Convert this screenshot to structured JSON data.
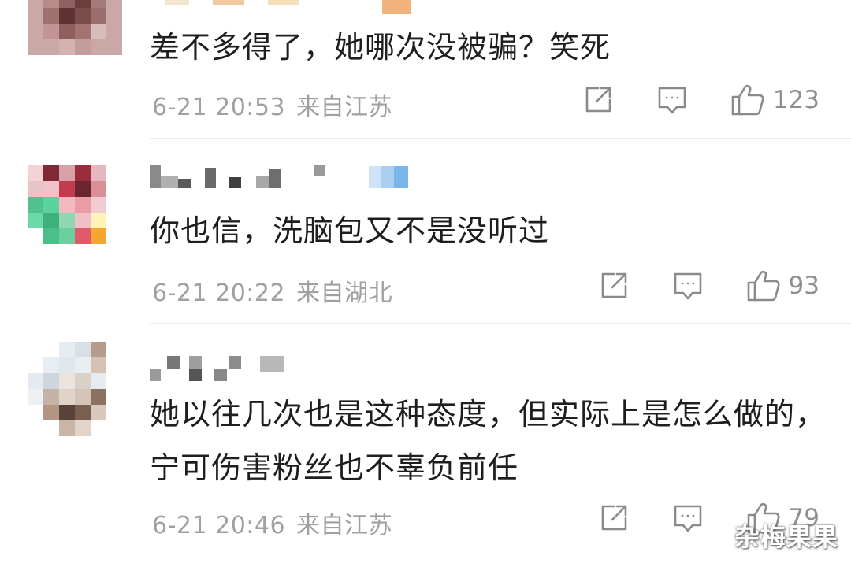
{
  "comments": [
    {
      "text": "差不多得了，她哪次没被骗？笑死",
      "time": "6-21 20:53",
      "location": "来自江苏",
      "likes": "123"
    },
    {
      "text": "你也信，洗脑包又不是没听过",
      "time": "6-21 20:22",
      "location": "来自湖北",
      "likes": "93"
    },
    {
      "text": "她以往几次也是这种态度，但实际上是怎么做的，宁可伤害粉丝也不辜负前任",
      "time": "6-21 20:46",
      "location": "来自江苏",
      "likes": "79"
    }
  ],
  "icons": {
    "share": "share-icon",
    "comment": "comment-icon",
    "like": "thumbs-up-icon"
  },
  "colors": {
    "text": "#1e1e1e",
    "meta": "#a0a0a0",
    "icon": "#8a8a8a",
    "divider": "#eeeeee"
  },
  "watermark": "杂梅果果"
}
